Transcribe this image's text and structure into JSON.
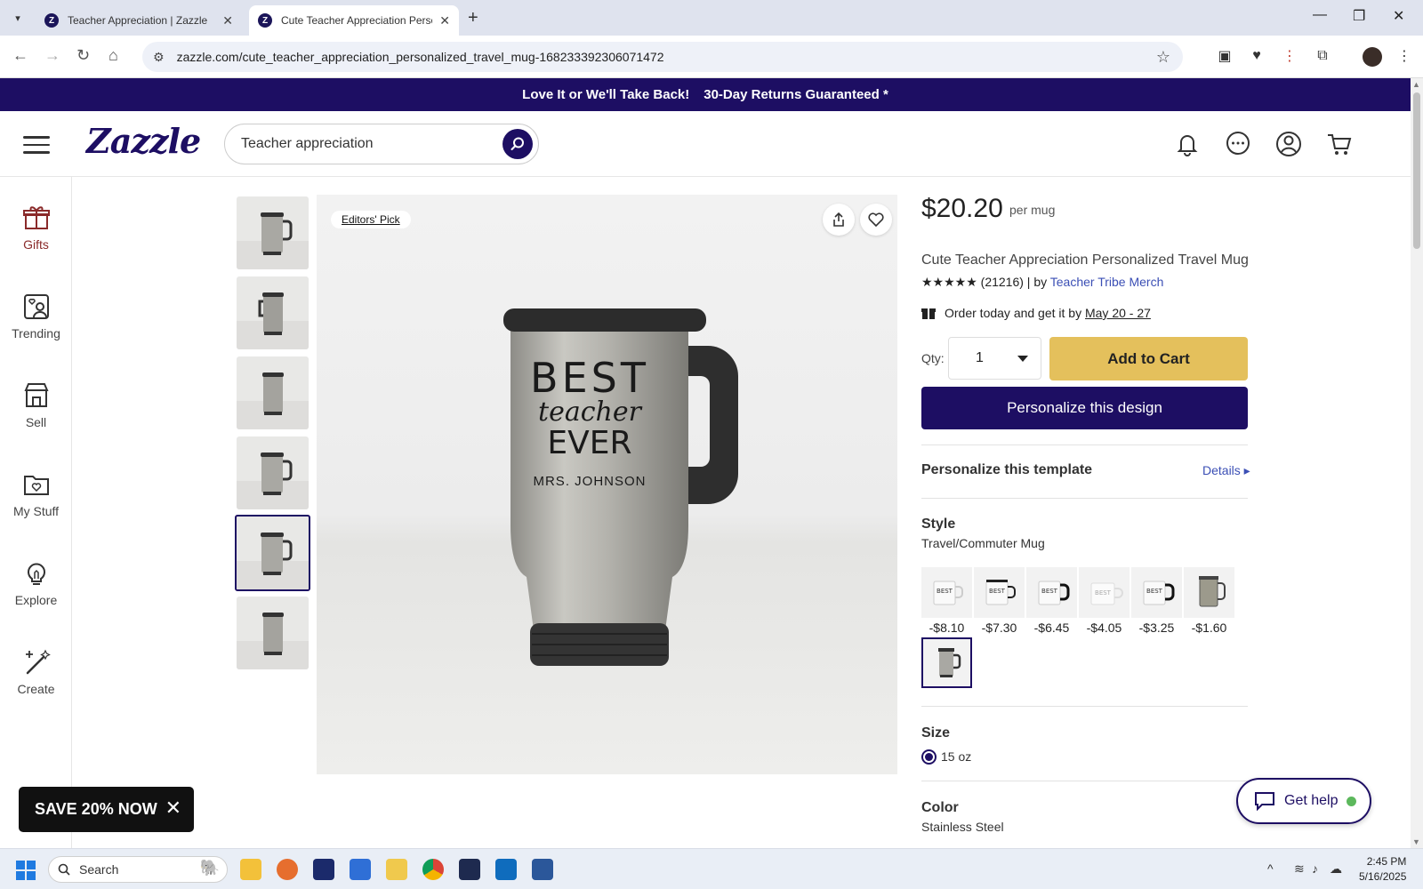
{
  "browser": {
    "tabs": [
      {
        "title": "Teacher Appreciation | Zazzle"
      },
      {
        "title": "Cute Teacher Appreciation Personal"
      }
    ],
    "url": "zazzle.com/cute_teacher_appreciation_personalized_travel_mug-168233392306071472"
  },
  "promo": {
    "part1": "Love It or We'll Take Back!",
    "part2": "30-Day Returns Guaranteed *"
  },
  "header": {
    "logo": "Zazzle",
    "search_value": "Teacher appreciation"
  },
  "leftnav": {
    "items": [
      {
        "label": "Gifts"
      },
      {
        "label": "Trending"
      },
      {
        "label": "Sell"
      },
      {
        "label": "My Stuff"
      },
      {
        "label": "Explore"
      },
      {
        "label": "Create"
      }
    ]
  },
  "gallery": {
    "badge": "Editors' Pick",
    "mug_text": {
      "line1": "BEST",
      "line2": "teacher",
      "line3": "EVER",
      "name": "MRS. JOHNSON"
    }
  },
  "product": {
    "price": "$20.20",
    "per_unit": "per mug",
    "title": "Cute Teacher Appreciation Personalized Travel Mug",
    "stars": "★★★★★",
    "reviews": "(21216) | by",
    "seller": "Teacher Tribe Merch",
    "order_text": "Order today and get it by",
    "delivery": "May 20 - 27",
    "qty_label": "Qty:",
    "qty_value": "1",
    "add_to_cart": "Add to Cart",
    "personalize_btn": "Personalize this design",
    "template_label": "Personalize this template",
    "details_link": "Details ▸",
    "style_label": "Style",
    "style_value": "Travel/Commuter Mug",
    "style_prices": [
      "-$8.10",
      "-$7.30",
      "-$6.45",
      "-$4.05",
      "-$3.25",
      "-$1.60"
    ],
    "size_label": "Size",
    "size_value": "15 oz",
    "color_label": "Color",
    "color_value": "Stainless Steel"
  },
  "widgets": {
    "get_help": "Get help",
    "save_banner": "SAVE 20% NOW"
  },
  "taskbar": {
    "search_placeholder": "Search",
    "time": "2:45 PM",
    "date": "5/16/2025"
  },
  "colors": {
    "brand": "#1d0e63",
    "cart_button": "#e4c05c",
    "link": "#3b4fb5"
  }
}
